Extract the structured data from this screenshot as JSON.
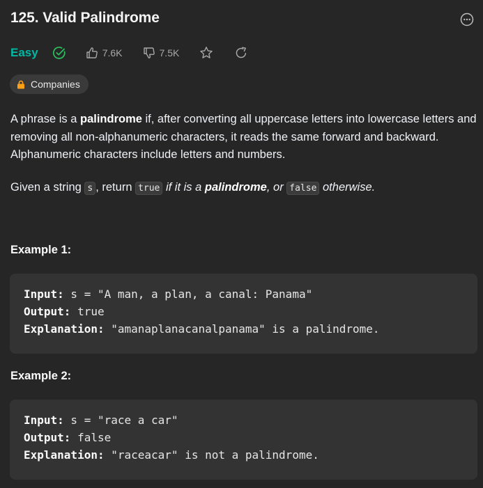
{
  "problem": {
    "title": "125. Valid Palindrome",
    "difficulty": "Easy",
    "likes": "7.6K",
    "dislikes": "7.5K",
    "companies_label": "Companies"
  },
  "description": {
    "p1_a": "A phrase is a ",
    "p1_bold": "palindrome",
    "p1_b": " if, after converting all uppercase letters into lowercase letters and removing all non-alphanumeric characters, it reads the same forward and backward. Alphanumeric characters include letters and numbers.",
    "p2_a": "Given a string ",
    "p2_code_s": "s",
    "p2_b": ", return ",
    "p2_code_true": "true",
    "p2_c": " if it is a ",
    "p2_bold": "palindrome",
    "p2_d": ", or ",
    "p2_code_false": "false",
    "p2_e": " otherwise."
  },
  "examples": [
    {
      "heading": "Example 1:",
      "input_label": "Input:",
      "input_value": " s = \"A man, a plan, a canal: Panama\"",
      "output_label": "Output:",
      "output_value": " true",
      "explanation_label": "Explanation:",
      "explanation_value": " \"amanaplanacanalpanama\" is a palindrome."
    },
    {
      "heading": "Example 2:",
      "input_label": "Input:",
      "input_value": " s = \"race a car\"",
      "output_label": "Output:",
      "output_value": " false",
      "explanation_label": "Explanation:",
      "explanation_value": " \"raceacar\" is not a palindrome."
    }
  ],
  "icons": {
    "more": "more-options-icon",
    "solved": "solved-check-icon",
    "like": "thumbs-up-icon",
    "dislike": "thumbs-down-icon",
    "favorite": "star-icon",
    "share": "share-refresh-icon",
    "lock": "lock-icon"
  },
  "colors": {
    "easy": "#00b8a3",
    "background": "#262626",
    "code_block": "#333333",
    "lock": "#ffa116"
  }
}
